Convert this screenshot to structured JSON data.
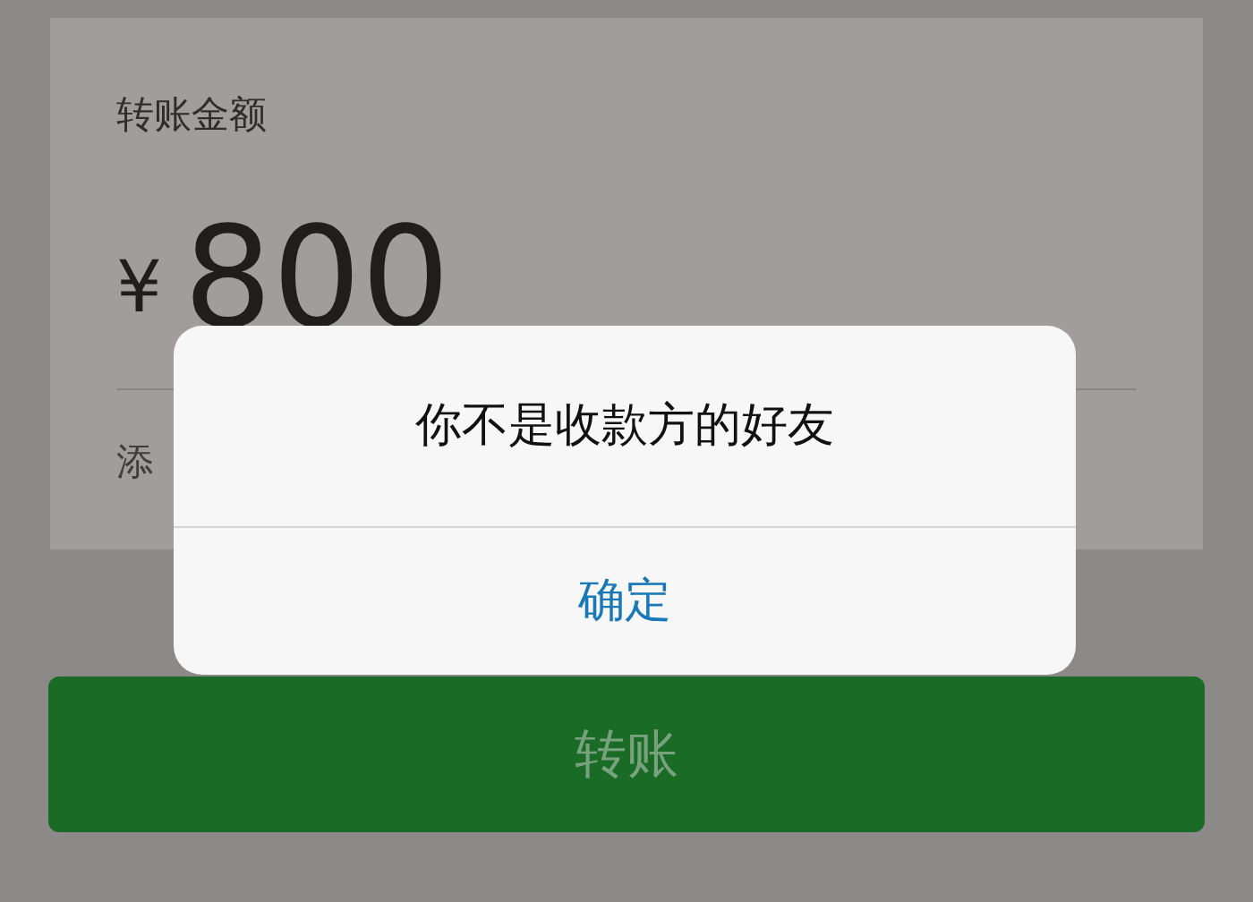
{
  "transfer_card": {
    "label": "转账金额",
    "currency": "¥",
    "amount": "800",
    "note_link": "添"
  },
  "transfer_button": {
    "label": "转账",
    "disabled": true
  },
  "dialog": {
    "message": "你不是收款方的好友",
    "buttons": [
      "确定"
    ]
  }
}
